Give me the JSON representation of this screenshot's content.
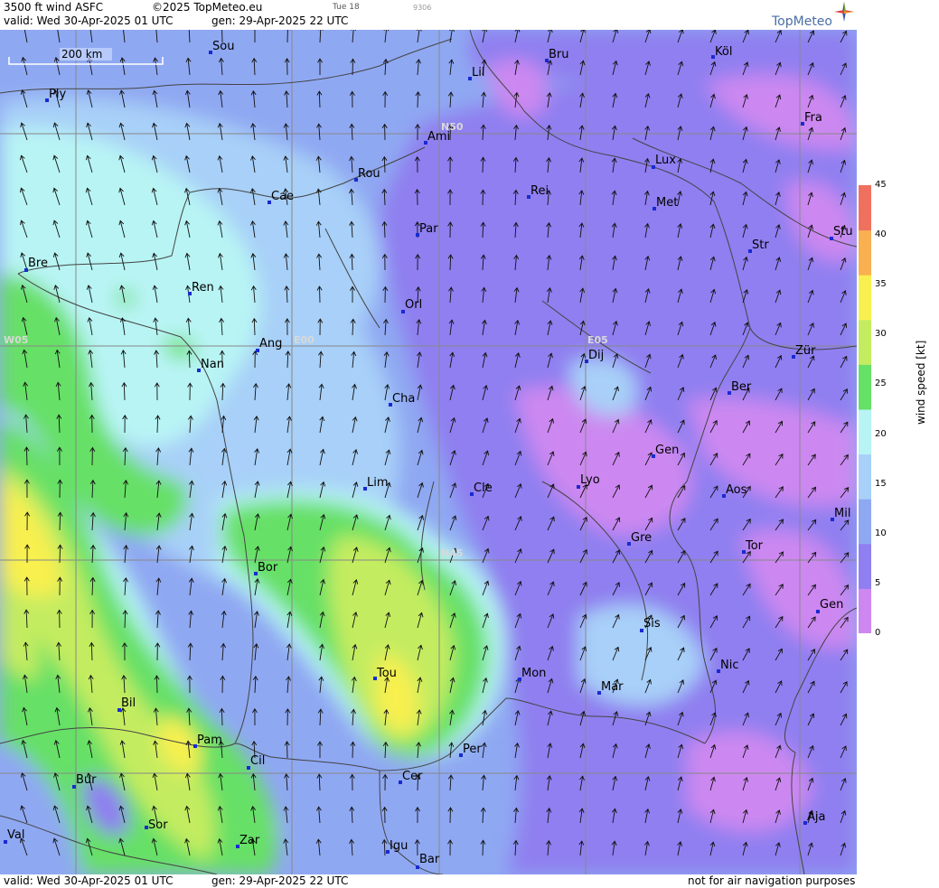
{
  "header": {
    "product": "3500 ft wind ASFC",
    "copyright": "©2025 TopMeteo.eu",
    "day_tab": "Tue 18",
    "code": "9306",
    "valid": "valid:  Wed  30-Apr-2025  01 UTC",
    "gen": "gen: 29-Apr-2025 22 UTC",
    "brand": "TopMeteo"
  },
  "footer": {
    "valid": "valid:  Wed  30-Apr-2025  01 UTC",
    "gen": "gen: 29-Apr-2025 22 UTC",
    "disclaimer": "not for air navigation purposes"
  },
  "scale_bar": {
    "label": "200 km"
  },
  "grid_labels": [
    {
      "text": "N50"
    },
    {
      "text": "N45"
    },
    {
      "text": "W05"
    },
    {
      "text": "E00"
    },
    {
      "text": "E05"
    }
  ],
  "cities": [
    {
      "name": "Sou"
    },
    {
      "name": "Bru"
    },
    {
      "name": "Köl"
    },
    {
      "name": "Lil"
    },
    {
      "name": "Ply"
    },
    {
      "name": "Fra"
    },
    {
      "name": "Ami"
    },
    {
      "name": "Lux"
    },
    {
      "name": "Rou"
    },
    {
      "name": "Cae"
    },
    {
      "name": "Rei"
    },
    {
      "name": "Met"
    },
    {
      "name": "Par"
    },
    {
      "name": "Stu"
    },
    {
      "name": "Str"
    },
    {
      "name": "Bre"
    },
    {
      "name": "Ren"
    },
    {
      "name": "Orl"
    },
    {
      "name": "Ang"
    },
    {
      "name": "Nan"
    },
    {
      "name": "Dij"
    },
    {
      "name": "Zür"
    },
    {
      "name": "Ber"
    },
    {
      "name": "Cha"
    },
    {
      "name": "Gen"
    },
    {
      "name": "Lim"
    },
    {
      "name": "Cle"
    },
    {
      "name": "Lyo"
    },
    {
      "name": "Aos"
    },
    {
      "name": "Mil"
    },
    {
      "name": "Gre"
    },
    {
      "name": "Tor"
    },
    {
      "name": "Bor"
    },
    {
      "name": "Gen"
    },
    {
      "name": "Sis"
    },
    {
      "name": "Nic"
    },
    {
      "name": "Tou"
    },
    {
      "name": "Mon"
    },
    {
      "name": "Mar"
    },
    {
      "name": "Bil"
    },
    {
      "name": "Pam"
    },
    {
      "name": "Cil"
    },
    {
      "name": "Per"
    },
    {
      "name": "Cer"
    },
    {
      "name": "Bur"
    },
    {
      "name": "Sor"
    },
    {
      "name": "Val"
    },
    {
      "name": "Zar"
    },
    {
      "name": "Igu"
    },
    {
      "name": "Bar"
    },
    {
      "name": "Aja"
    }
  ],
  "legend": {
    "title": "wind speed [kt]",
    "ticks": [
      "0",
      "5",
      "10",
      "15",
      "20",
      "25",
      "30",
      "35",
      "40",
      "45"
    ],
    "colors": [
      "#cc88f0",
      "#8f7ff0",
      "#8fa8f2",
      "#a8d0f8",
      "#b8f4f4",
      "#66e066",
      "#c4ec60",
      "#f8f050",
      "#f8b050",
      "#f07060"
    ]
  },
  "colors": {
    "calm": "#cc88f0",
    "light": "#8f7ff0",
    "moderate": "#8fa8f2",
    "fresh": "#a8d0f8",
    "cyan": "#b8f4f4",
    "green": "#66e066",
    "yellowgreen": "#c4ec60",
    "yellow": "#f8f050"
  }
}
